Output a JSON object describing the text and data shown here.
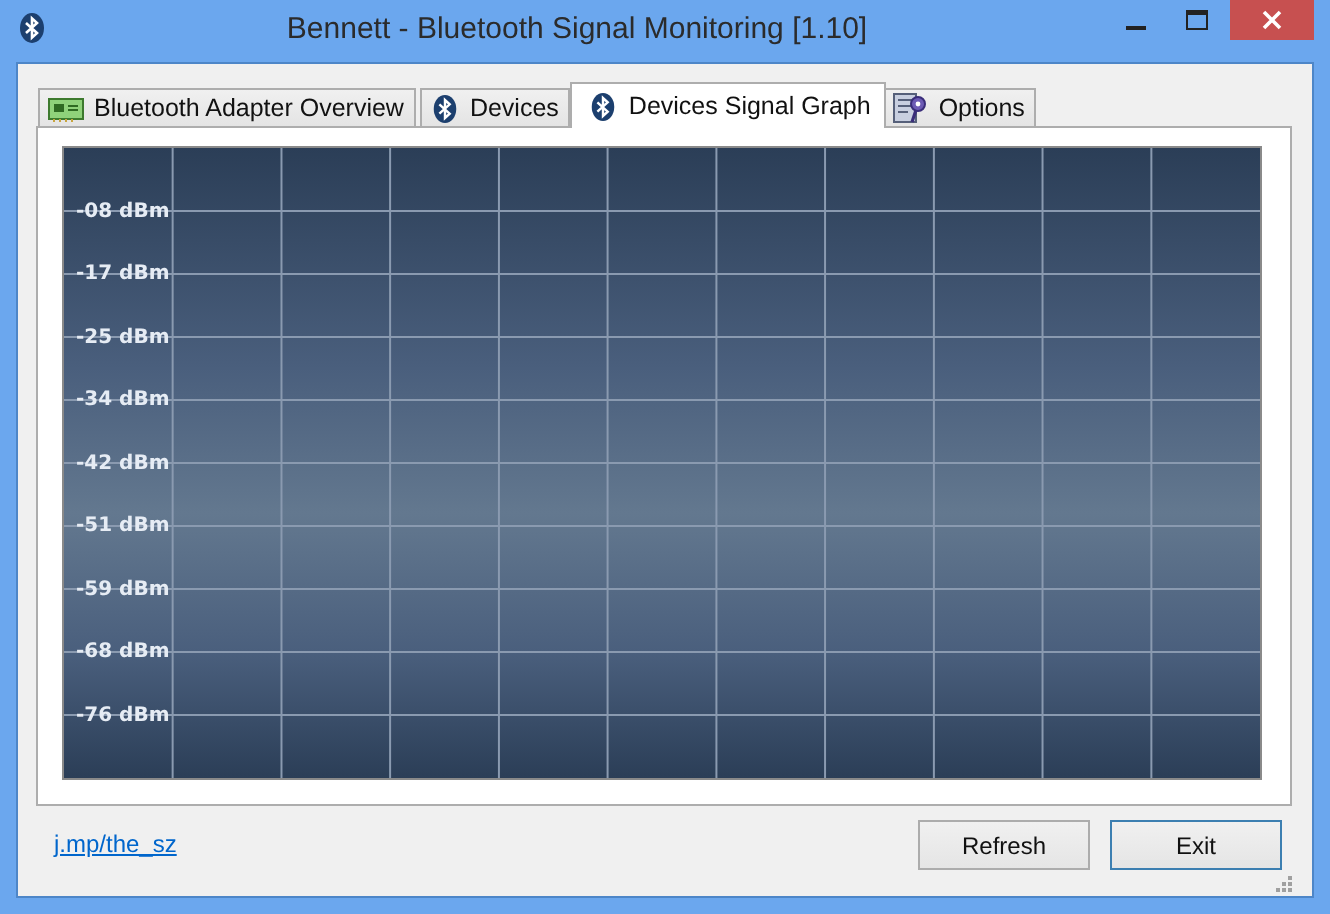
{
  "window": {
    "title": "Bennett - Bluetooth Signal Monitoring [1.10]"
  },
  "tabs": [
    {
      "label": "Bluetooth Adapter Overview",
      "kind": "adapter",
      "selected": false
    },
    {
      "label": "Devices",
      "kind": "bluetooth",
      "selected": false
    },
    {
      "label": "Devices Signal Graph",
      "kind": "bluetooth",
      "selected": true
    },
    {
      "label": "Options",
      "kind": "options",
      "selected": false
    }
  ],
  "graph": {
    "y_labels": [
      "-08 dBm",
      "-17 dBm",
      "-25 dBm",
      "-34 dBm",
      "-42 dBm",
      "-51 dBm",
      "-59 dBm",
      "-68 dBm",
      "-76 dBm"
    ]
  },
  "footer": {
    "link": "j.mp/the_sz"
  },
  "buttons": [
    {
      "label": "Refresh",
      "default": false
    },
    {
      "label": "Exit",
      "default": true
    }
  ]
}
